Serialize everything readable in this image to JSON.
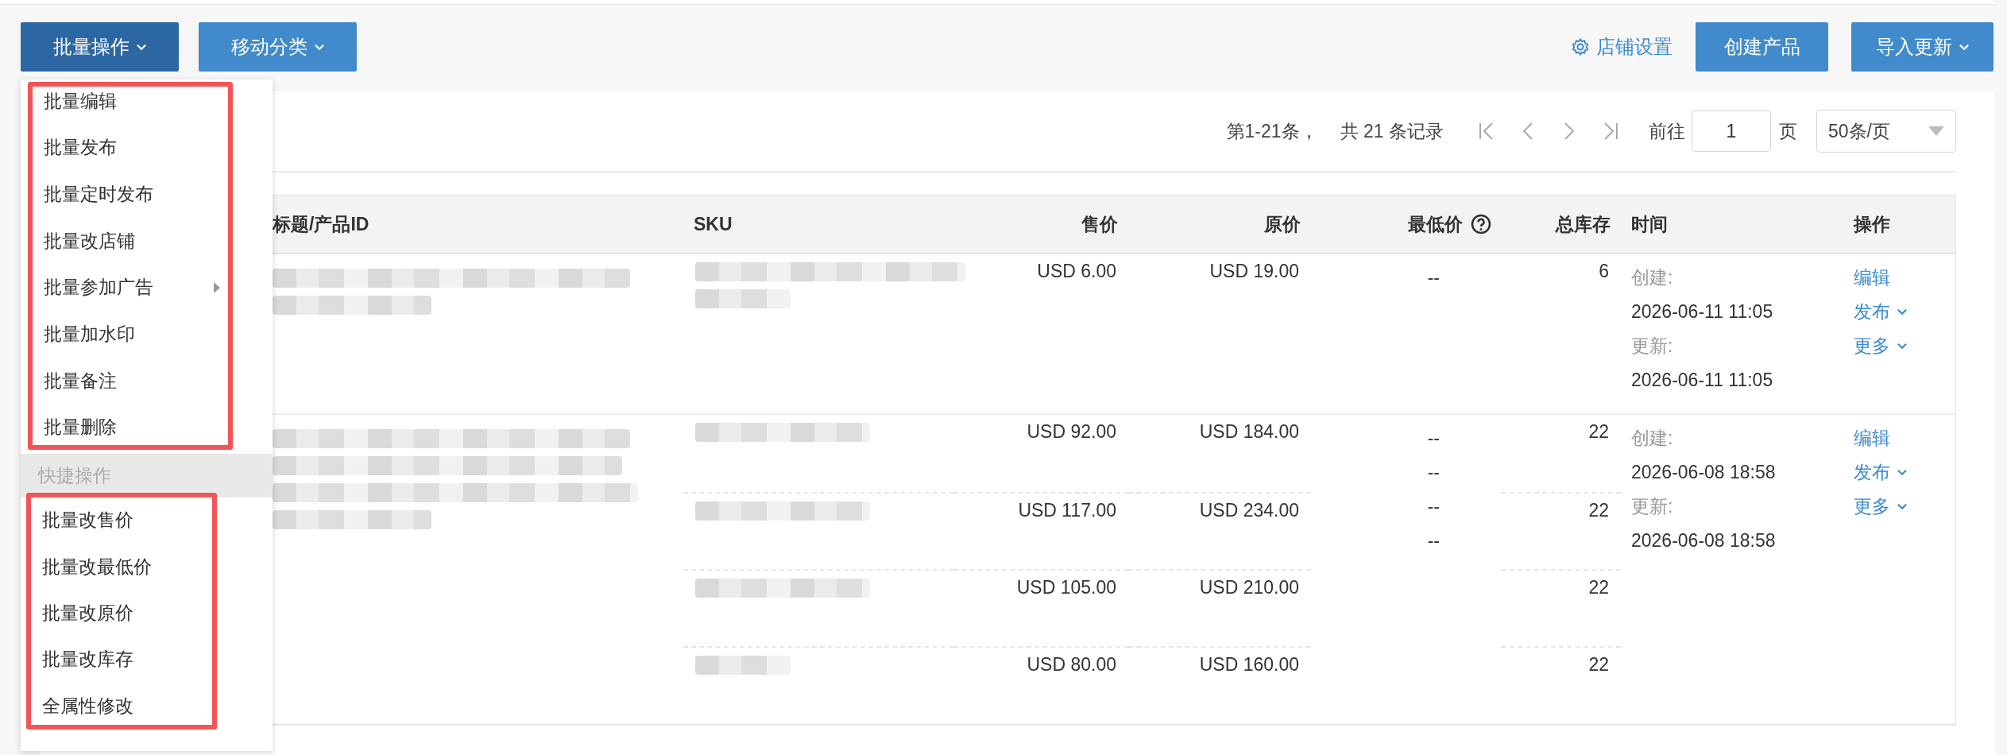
{
  "toolbar": {
    "left_buttons": [
      {
        "label": "批量操作",
        "selected": true,
        "dropdown": true
      },
      {
        "label": "移动分类",
        "selected": false,
        "dropdown": true
      }
    ],
    "settings_link": "店铺设置",
    "right_buttons": [
      {
        "label": "创建产品",
        "dropdown": false
      },
      {
        "label": "导入更新",
        "dropdown": true
      }
    ]
  },
  "pagination": {
    "range": "第1-21条，",
    "total": "共 21 条记录",
    "goto_label": "前往",
    "page": "1",
    "page_unit": "页",
    "page_size": "50条/页"
  },
  "table": {
    "columns": [
      {
        "label": "标题/产品ID",
        "help": false
      },
      {
        "label": "SKU",
        "help": false
      },
      {
        "label": "售价",
        "help": false
      },
      {
        "label": "原价",
        "help": false
      },
      {
        "label": "最低价",
        "help": true
      },
      {
        "label": "总库存",
        "help": false
      },
      {
        "label": "时间",
        "help": false
      },
      {
        "label": "操作",
        "help": false
      }
    ],
    "rows": [
      {
        "skus": [
          {
            "price": "USD 6.00",
            "original_price": "USD 19.00",
            "stock": "6"
          }
        ],
        "min_prices": [
          "--"
        ],
        "created_label": "创建:",
        "created": "2026-06-11 11:05",
        "updated_label": "更新:",
        "updated": "2026-06-11 11:05",
        "actions": [
          {
            "label": "编辑",
            "dropdown": false
          },
          {
            "label": "发布",
            "dropdown": true
          },
          {
            "label": "更多",
            "dropdown": true
          }
        ]
      },
      {
        "skus": [
          {
            "price": "USD 92.00",
            "original_price": "USD 184.00",
            "stock": "22"
          },
          {
            "price": "USD 117.00",
            "original_price": "USD 234.00",
            "stock": "22"
          },
          {
            "price": "USD 105.00",
            "original_price": "USD 210.00",
            "stock": "22"
          },
          {
            "price": "USD 80.00",
            "original_price": "USD 160.00",
            "stock": "22"
          }
        ],
        "min_prices": [
          "--",
          "--",
          "--",
          "--"
        ],
        "created_label": "创建:",
        "created": "2026-06-08 18:58",
        "updated_label": "更新:",
        "updated": "2026-06-08 18:58",
        "actions": [
          {
            "label": "编辑",
            "dropdown": false
          },
          {
            "label": "发布",
            "dropdown": true
          },
          {
            "label": "更多",
            "dropdown": true
          }
        ]
      }
    ]
  },
  "dropdown_menu": {
    "sections": [
      {
        "items": [
          {
            "label": "批量编辑",
            "submenu": false
          },
          {
            "label": "批量发布",
            "submenu": false
          },
          {
            "label": "批量定时发布",
            "submenu": false
          },
          {
            "label": "批量改店铺",
            "submenu": false
          },
          {
            "label": "批量参加广告",
            "submenu": true
          },
          {
            "label": "批量加水印",
            "submenu": false
          },
          {
            "label": "批量备注",
            "submenu": false
          },
          {
            "label": "批量删除",
            "submenu": false
          }
        ]
      },
      {
        "header": "快捷操作",
        "items": [
          {
            "label": "批量改售价",
            "submenu": false
          },
          {
            "label": "批量改最低价",
            "submenu": false
          },
          {
            "label": "批量改原价",
            "submenu": false
          },
          {
            "label": "批量改库存",
            "submenu": false
          },
          {
            "label": "全属性修改",
            "submenu": false
          }
        ]
      }
    ]
  }
}
